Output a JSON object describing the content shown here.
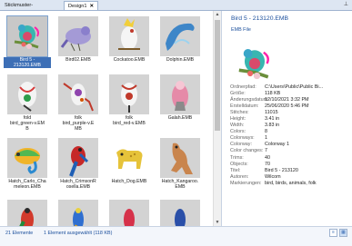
{
  "tabs": [
    {
      "label": "Stickmuster-Bibliothek",
      "close": "✕"
    },
    {
      "label": "Design1",
      "close": "✕"
    }
  ],
  "pin_glyph": "⊥",
  "gallery": {
    "items": [
      {
        "label": "Bird 5 -\n213120.EMB",
        "selected": true
      },
      {
        "label": "Bird02.EMB"
      },
      {
        "label": "Cockatoo.EMB"
      },
      {
        "label": "Dolphin.EMB"
      },
      {
        "label": "fold\nbird_green-v.EM\nB"
      },
      {
        "label": "folk\nbird_purple-v.E\nMB"
      },
      {
        "label": "folk\nbird_red-v.EMB"
      },
      {
        "label": "Galah.EMB"
      },
      {
        "label": "Hatch_Carlo_Cha\nmeleon.EMB"
      },
      {
        "label": "Hatch_CrimsonR\nosella.EMB"
      },
      {
        "label": "Hatch_Dog.EMB"
      },
      {
        "label": "Hatch_Kangaroo.\nEMB"
      },
      {
        "label": ""
      },
      {
        "label": ""
      },
      {
        "label": ""
      },
      {
        "label": ""
      }
    ]
  },
  "preview": {
    "title": "Bird 5 - 213120.EMB",
    "subtitle": "EMB File",
    "properties": [
      {
        "key": "Ordnerpfad:",
        "value": "C:\\Users\\Public\\Public Bi..."
      },
      {
        "key": "Größe:",
        "value": "118 KB"
      },
      {
        "key": "Änderungsdatum:",
        "value": "12/10/2021 3:32 PM"
      },
      {
        "key": "Erstelldatum:",
        "value": "25/06/2020 5:46 PM"
      },
      {
        "key": "Stitches:",
        "value": "11015"
      },
      {
        "key": "Height:",
        "value": "3.41 in"
      },
      {
        "key": "Width:",
        "value": "3.83 in"
      },
      {
        "key": "Colors:",
        "value": "8"
      },
      {
        "key": "Colorways:",
        "value": "1"
      },
      {
        "key": "Colorway:",
        "value": "Colorway 1"
      },
      {
        "key": "Color changes:",
        "value": "7"
      },
      {
        "key": "Trims:",
        "value": "40"
      },
      {
        "key": "Objects:",
        "value": "70"
      },
      {
        "key": "Titel:",
        "value": "Bird 5 - 213120"
      },
      {
        "key": "Autoren:",
        "value": "Wilcom"
      },
      {
        "key": "Markierungen:",
        "value": "bird, birds, animals, folk"
      }
    ]
  },
  "status": {
    "count": "21 Elemente",
    "selection": "1 Element ausgewählt (118 KB)"
  },
  "icons": {
    "view_details": "details-view-icon",
    "view_thumbs": "thumbnail-view-icon",
    "scroll_up": "scroll-up-icon",
    "scroll_down": "scroll-down-icon"
  }
}
